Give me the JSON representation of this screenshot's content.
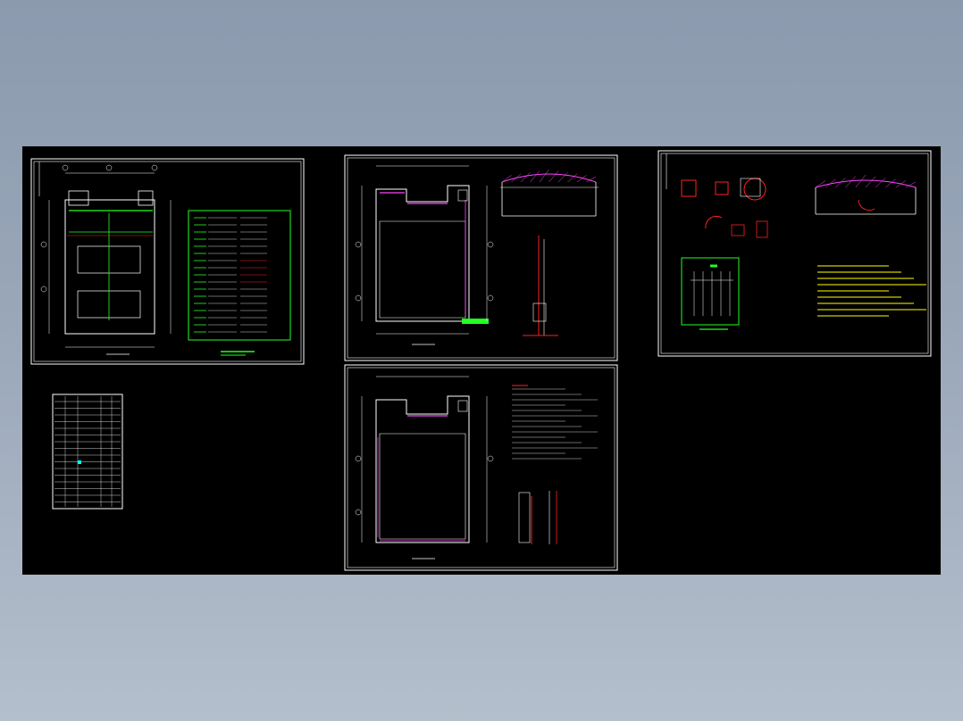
{
  "viewer": {
    "background_top": "#8b9aae",
    "background_bottom": "#b4bfcc",
    "viewport_bg": "#000000"
  },
  "colors": {
    "frame": "#ffffff",
    "wall": "#ffffff",
    "accent_magenta": "#ff44ff",
    "accent_red": "#ff2020",
    "accent_green": "#22ff22",
    "accent_yellow": "#ffff00",
    "accent_cyan": "#00ffff",
    "dim_text": "#cfcfcf"
  },
  "sheets": [
    {
      "id": "electrical-plan",
      "content": "electrical"
    },
    {
      "id": "material-table",
      "content": "table"
    },
    {
      "id": "floor-plan-upper",
      "content": "plan"
    },
    {
      "id": "floor-plan-lower",
      "content": "plan"
    },
    {
      "id": "details-sheet",
      "content": "details"
    }
  ]
}
